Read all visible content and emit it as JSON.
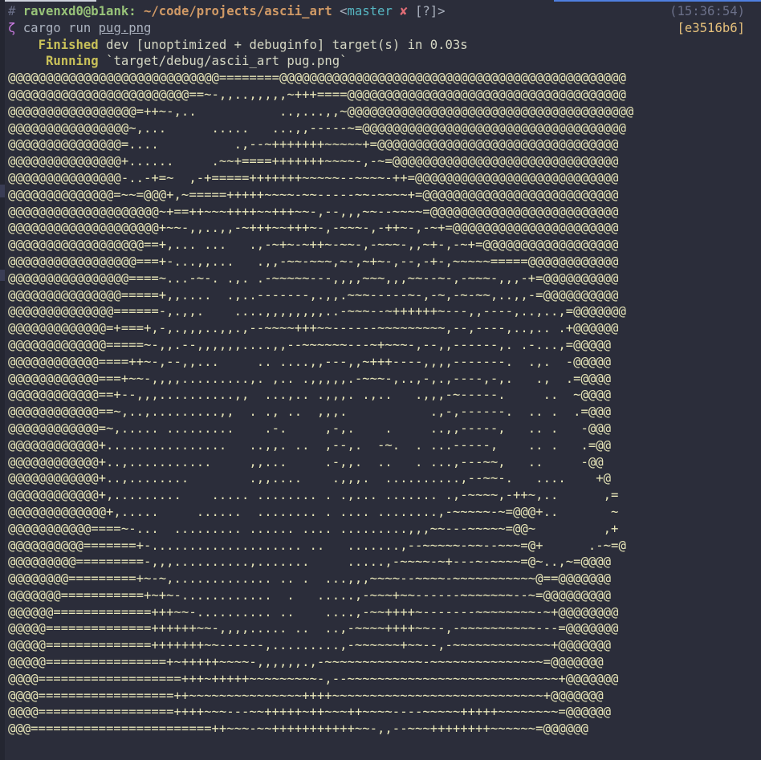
{
  "prompt": {
    "hash": "#",
    "user_host": "ravenxd0@b1ank:",
    "path": "~/code/projects/ascii_art",
    "branch_open": "<",
    "branch": "master",
    "dirty_mark": "✘",
    "status_flags": "[?]>",
    "time": "(15:36:54)"
  },
  "command": {
    "prefix": "ζ",
    "text": "cargo run",
    "argument": "pug.png",
    "commit": "[e3516b6]"
  },
  "output": {
    "finished_label": "Finished",
    "finished_text": "dev [unoptimized + debuginfo] target(s) in 0.03s",
    "running_label": "Running",
    "running_text": "`target/debug/ascii_art pug.png`"
  },
  "ascii_art": [
    "@@@@@@@@@@@@@@@@@@@@@@@@@@@@========@@@@@@@@@@@@@@@@@@@@@@@@@@@@@@@@@@@@@@@@@@@@@@",
    "@@@@@@@@@@@@@@@@@@@@@@@@==~-,,..,,,,,~+++====@@@@@@@@@@@@@@@@@@@@@@@@@@@@@@@@@@@@@",
    "@@@@@@@@@@@@@@@@@=++~-,..           ..,...,,~@@@@@@@@@@@@@@@@@@@@@@@@@@@@@@@@@@@@@@",
    "@@@@@@@@@@@@@@@@~,...      .....   ...,,-----~=@@@@@@@@@@@@@@@@@@@@@@@@@@@@@@@@@@@",
    "@@@@@@@@@@@@@@@=....          .,--~+++++++~~~~~+=@@@@@@@@@@@@@@@@@@@@@@@@@@@@@@@@",
    "@@@@@@@@@@@@@@@+......     .~~+====+++++++~~~~-,-~=@@@@@@@@@@@@@@@@@@@@@@@@@@@@@@",
    "@@@@@@@@@@@@@@@-..-+=~  ,-+=====+++++++~~~~~--~~~~-++=@@@@@@@@@@@@@@@@@@@@@@@@@@@",
    "@@@@@@@@@@@@@@=~~=@@@+,~=====+++++~~~~-~~-----~~-~~~~+=@@@@@@@@@@@@@@@@@@@@@@@@@@",
    "@@@@@@@@@@@@@@@@@@@@~+==++~~~++++~~+++~~-,--,,,~~--~~~~=@@@@@@@@@@@@@@@@@@@@@@@@@",
    "@@@@@@@@@@@@@@@@@@@@+~~-,,..,,-~+++~~+++~-,-~~~-,-++~-,-~+=@@@@@@@@@@@@@@@@@@@@@@",
    "@@@@@@@@@@@@@@@@@@==+,... ...   .,-~+~-~++~-~~-,-~~~-,,~+-,-~+=@@@@@@@@@@@@@@@@@@",
    "@@@@@@@@@@@@@@@@@===+-...,,...   .,,-~~-~~~,~-,~+~-,--,-+-,~~~~~=====@@@@@@@@@@@@",
    "@@@@@@@@@@@@@@@@====~...-~-. .,. .-~~~~~---,,,,~~~,,,~~--~-,-~~~-,,,-+=@@@@@@@@@@",
    "@@@@@@@@@@@@@@@=====+,,....  .,..-------,.,,.~~~-----~-,-~,-~-~~,..,,-=@@@@@@@@@@",
    "@@@@@@@@@@@@@@======-,.,,.    ....,,,,,,,,..-~~~--~++++++~---,,----,..,..,=@@@@@@@",
    "@@@@@@@@@@@@@=+===+,-,.,,,..,,.,--~~~~+++~~------~~~~~~~~~,--,----,..,.. .+@@@@@@",
    "@@@@@@@@@@@@@=====~-,,.--,,,,,,....,,--~~~~~~---~+~~~-,--,,------,. .-...,=@@@@@",
    "@@@@@@@@@@@@====++~-,--,,...     .. ....,,---,,~+++----,,,,-------.  .,.  -@@@@@",
    "@@@@@@@@@@@@===+~~-,,,,.........,. ,.. .,,,,,.-~~~-,..,-,.,----,-,.   .,  .=@@@@",
    "@@@@@@@@@@@@==+--,,,..........,,  ...,.. .,,,. .,..   .,,,-~-----.     ..  ~@@@@",
    "@@@@@@@@@@@@==~,..,.........,,  . ., ..  ,,,.           .,-,------.  .. .  .=@@@",
    "@@@@@@@@@@@@=~,..... .........    .-.     ,-,.    .     ..,,-----,   .. .   -@@@",
    "@@@@@@@@@@@@+................   ..,,. ..  ,--,.  -~.  . ...-----,    .. .   .=@@",
    "@@@@@@@@@@@@+..,...........     ,,...     .-,,.  ..   . ...,---~~,   ..     -@@",
    "@@@@@@@@@@@@+..,........        .,,....    .,,,.  ..........,--~~-.   ....    +@",
    "@@@@@@@@@@@@+,.........    ..... ........ . .,... ....... .,-~~~~,-++~,..      ,=",
    "@@@@@@@@@@@@@+,.....     ......  ........ . .... ........,-~~~~~-~=@@@+..       ~",
    "@@@@@@@@@@@====~-...  ......... ...... .... .........,,,~~---~~~~~=@@~         ,+",
    "@@@@@@@@@@=======+-.................... ..   .......,--~~~~~-~~--~~~=@+      .-~=@",
    "@@@@@@@@@=========-,,,..........,.......     .....,-~~~~-~+---~-~~~~=@~..,~=@@@@",
    "@@@@@@@@=========+~-~,............. .. .  ...,,,~~~~--~~~~-~~~~~~~~~~~@==@@@@@@@",
    "@@@@@@@===========+~+~-............  .   .....,-~~~+~~------~~~~~~~--~=@@@@@@@@@",
    "@@@@@@=============+++~~-.......... ..    ....,-~~++++~-------~~~~~~~~-~+@@@@@@@@",
    "@@@@@==============++++++~~-,,,,..... ..  ..,-~~~~++++~~--,-~~~~~~~~~~---=@@@@@@@",
    "@@@@@==============+++++++~~------,.........,-~~~~~~+~~--,-~~~~~~~~~~~~~+@@@@@@@",
    "@@@@@================+~+++++~~~~-,,,,,,.,-~~~~~~~~~~~~~-~~~~~~~~~~~~~~~=@@@@@@@",
    "@@@@===================+++~+++++~~~~~~~~~-,--~~~~~~~~~~~~~~~~~~~~~~~~~~~~+@@@@@@@",
    "@@@@==================++~~~~~~~~~~~~~~~++++~~~~~~~~~~~~~~~~~~~~~~~~~~~~+@@@@@@@",
    "@@@@==================++++~~~---~~+++++~++~~~++~~~~----~~~~~+++++~~~~~~~~=@@@@@@",
    "@@@========================++~~~-~~+++++++++++~~-,,--~~~++++++++~~~~~~=@@@@@@"
  ]
}
